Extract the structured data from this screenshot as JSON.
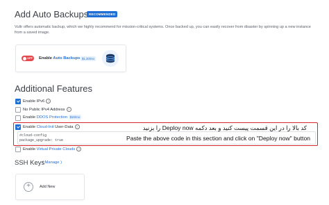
{
  "auto_backups": {
    "title": "Add Auto Backups",
    "badge": "RECOMMENDED",
    "description": "Vultr offers automatic backup, which we highly recommend for mission-critical systems. Once backed up, you can easily recover from disaster by spinning up a new instance from a saved image.",
    "toggle_state": "OFF",
    "enable_prefix": "Enable ",
    "enable_link": "Auto Backups",
    "price": "$1.20/mo"
  },
  "additional_features": {
    "title": "Additional Features",
    "items": [
      {
        "label": "Enable IPv6",
        "checked": true,
        "info": "?"
      },
      {
        "label": "No Public IPv4 Address",
        "checked": false,
        "info": "?"
      },
      {
        "label_prefix": "Enable ",
        "link": "DDOS Protection",
        "price": "$10/mo",
        "checked": false
      }
    ],
    "cloud_init": {
      "label_prefix": "Enable ",
      "link": "Cloud-Init",
      "label_suffix": " User-Data",
      "info": "?",
      "checked": true,
      "code_line1": "#cloud-config",
      "code_line2": "package_upgrade: true"
    },
    "vpc": {
      "label_prefix": "Enable ",
      "link": "Virtual Private Clouds",
      "info": "?",
      "checked": false
    }
  },
  "annotations": {
    "persian": "کد بالا را در این قسمت پیست کنید و بعد دکمه Deploy now را بزنید",
    "english": "Paste the above code in this section and click on \"Deploy now\" button"
  },
  "ssh_keys": {
    "title": "SSH Keys",
    "manage": "( Manage )",
    "add_label": "Add New",
    "add_icon": "+"
  },
  "colors": {
    "accent": "#1f6fd6",
    "toggle_off": "#e5484d",
    "highlight_border": "#d6262b"
  },
  "icons": [
    "database-backup-icon",
    "info-icon",
    "plus-circle-icon"
  ]
}
